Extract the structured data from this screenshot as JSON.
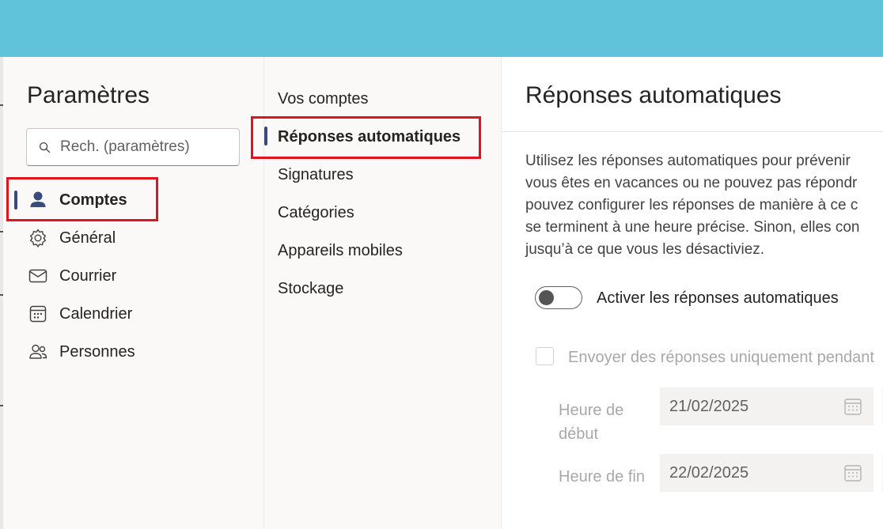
{
  "sidebar": {
    "title": "Paramètres",
    "search_placeholder": "Rech. (paramètres)",
    "items": [
      {
        "label": "Comptes",
        "icon": "person-icon",
        "active": true
      },
      {
        "label": "Général",
        "icon": "gear-icon",
        "active": false
      },
      {
        "label": "Courrier",
        "icon": "mail-icon",
        "active": false
      },
      {
        "label": "Calendrier",
        "icon": "calendar-icon",
        "active": false
      },
      {
        "label": "Personnes",
        "icon": "people-icon",
        "active": false
      }
    ]
  },
  "subnav": {
    "items": [
      {
        "label": "Vos comptes",
        "active": false
      },
      {
        "label": "Réponses automatiques",
        "active": true
      },
      {
        "label": "Signatures",
        "active": false
      },
      {
        "label": "Catégories",
        "active": false
      },
      {
        "label": "Appareils mobiles",
        "active": false
      },
      {
        "label": "Stockage",
        "active": false
      }
    ]
  },
  "main": {
    "title": "Réponses automatiques",
    "description_lines": [
      "Utilisez les réponses automatiques pour prévenir",
      "vous êtes en vacances ou ne pouvez pas répondr",
      "pouvez configurer les réponses de manière à ce c",
      "se terminent à une heure précise. Sinon, elles con",
      "jusqu’à ce que vous les désactiviez."
    ],
    "toggle_label": "Activer les réponses automatiques",
    "toggle_on": false,
    "checkbox_label": "Envoyer des réponses uniquement pendant",
    "checkbox_checked": false,
    "start_label_line1": "Heure de",
    "start_label_line2": "début",
    "start_date": "21/02/2025",
    "end_label": "Heure de fin",
    "end_date": "22/02/2025"
  },
  "colors": {
    "topbar": "#61c3d9",
    "indicator": "#3a4a7a",
    "highlight_box": "#e0141e"
  }
}
